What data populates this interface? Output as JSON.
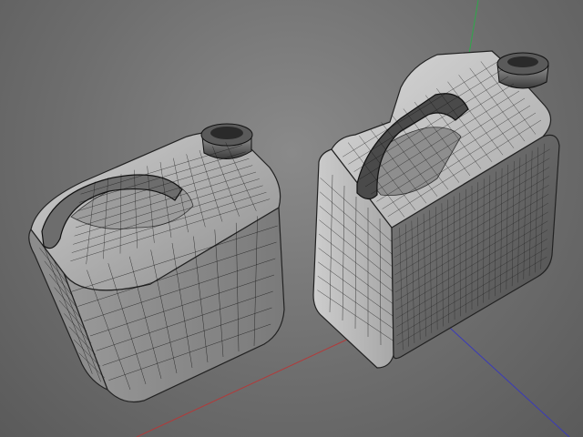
{
  "viewport": {
    "background_color": "#777777",
    "mesh_line_color": "#111111",
    "surface_color": "#a9a9a9",
    "surface_highlight": "#d9d9d9",
    "surface_shadow": "#5c5c5c"
  },
  "axes": {
    "x_color": "#b23a3a",
    "y_color": "#2fa84a",
    "z_color": "#3a3ab8"
  },
  "objects": [
    {
      "name": "jerrycan-left",
      "kind": "mesh",
      "show_wireframe": true
    },
    {
      "name": "jerrycan-right",
      "kind": "mesh",
      "show_wireframe": true
    }
  ]
}
